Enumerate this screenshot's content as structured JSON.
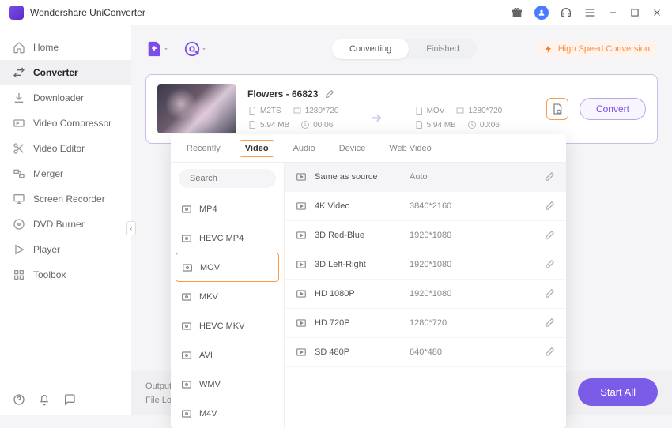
{
  "app": {
    "title": "Wondershare UniConverter"
  },
  "sidebar": {
    "items": [
      {
        "label": "Home"
      },
      {
        "label": "Converter"
      },
      {
        "label": "Downloader"
      },
      {
        "label": "Video Compressor"
      },
      {
        "label": "Video Editor"
      },
      {
        "label": "Merger"
      },
      {
        "label": "Screen Recorder"
      },
      {
        "label": "DVD Burner"
      },
      {
        "label": "Player"
      },
      {
        "label": "Toolbox"
      }
    ]
  },
  "toolbar": {
    "segments": {
      "converting": "Converting",
      "finished": "Finished"
    },
    "highspeed": "High Speed Conversion"
  },
  "file": {
    "name": "Flowers - 66823",
    "src": {
      "format": "M2TS",
      "resolution": "1280*720",
      "size": "5.94 MB",
      "duration": "00:06"
    },
    "dst": {
      "format": "MOV",
      "resolution": "1280*720",
      "size": "5.94 MB",
      "duration": "00:06"
    },
    "convert_label": "Convert"
  },
  "bottom": {
    "output": "Output",
    "file_loc": "File Loc",
    "start_all": "Start All"
  },
  "dropdown": {
    "tabs": [
      "Recently",
      "Video",
      "Audio",
      "Device",
      "Web Video"
    ],
    "active_tab_index": 1,
    "search_placeholder": "Search",
    "formats": [
      "MP4",
      "HEVC MP4",
      "MOV",
      "MKV",
      "HEVC MKV",
      "AVI",
      "WMV",
      "M4V"
    ],
    "selected_format_index": 2,
    "resolutions": [
      {
        "name": "Same as source",
        "value": "Auto"
      },
      {
        "name": "4K Video",
        "value": "3840*2160"
      },
      {
        "name": "3D Red-Blue",
        "value": "1920*1080"
      },
      {
        "name": "3D Left-Right",
        "value": "1920*1080"
      },
      {
        "name": "HD 1080P",
        "value": "1920*1080"
      },
      {
        "name": "HD 720P",
        "value": "1280*720"
      },
      {
        "name": "SD 480P",
        "value": "640*480"
      }
    ]
  }
}
